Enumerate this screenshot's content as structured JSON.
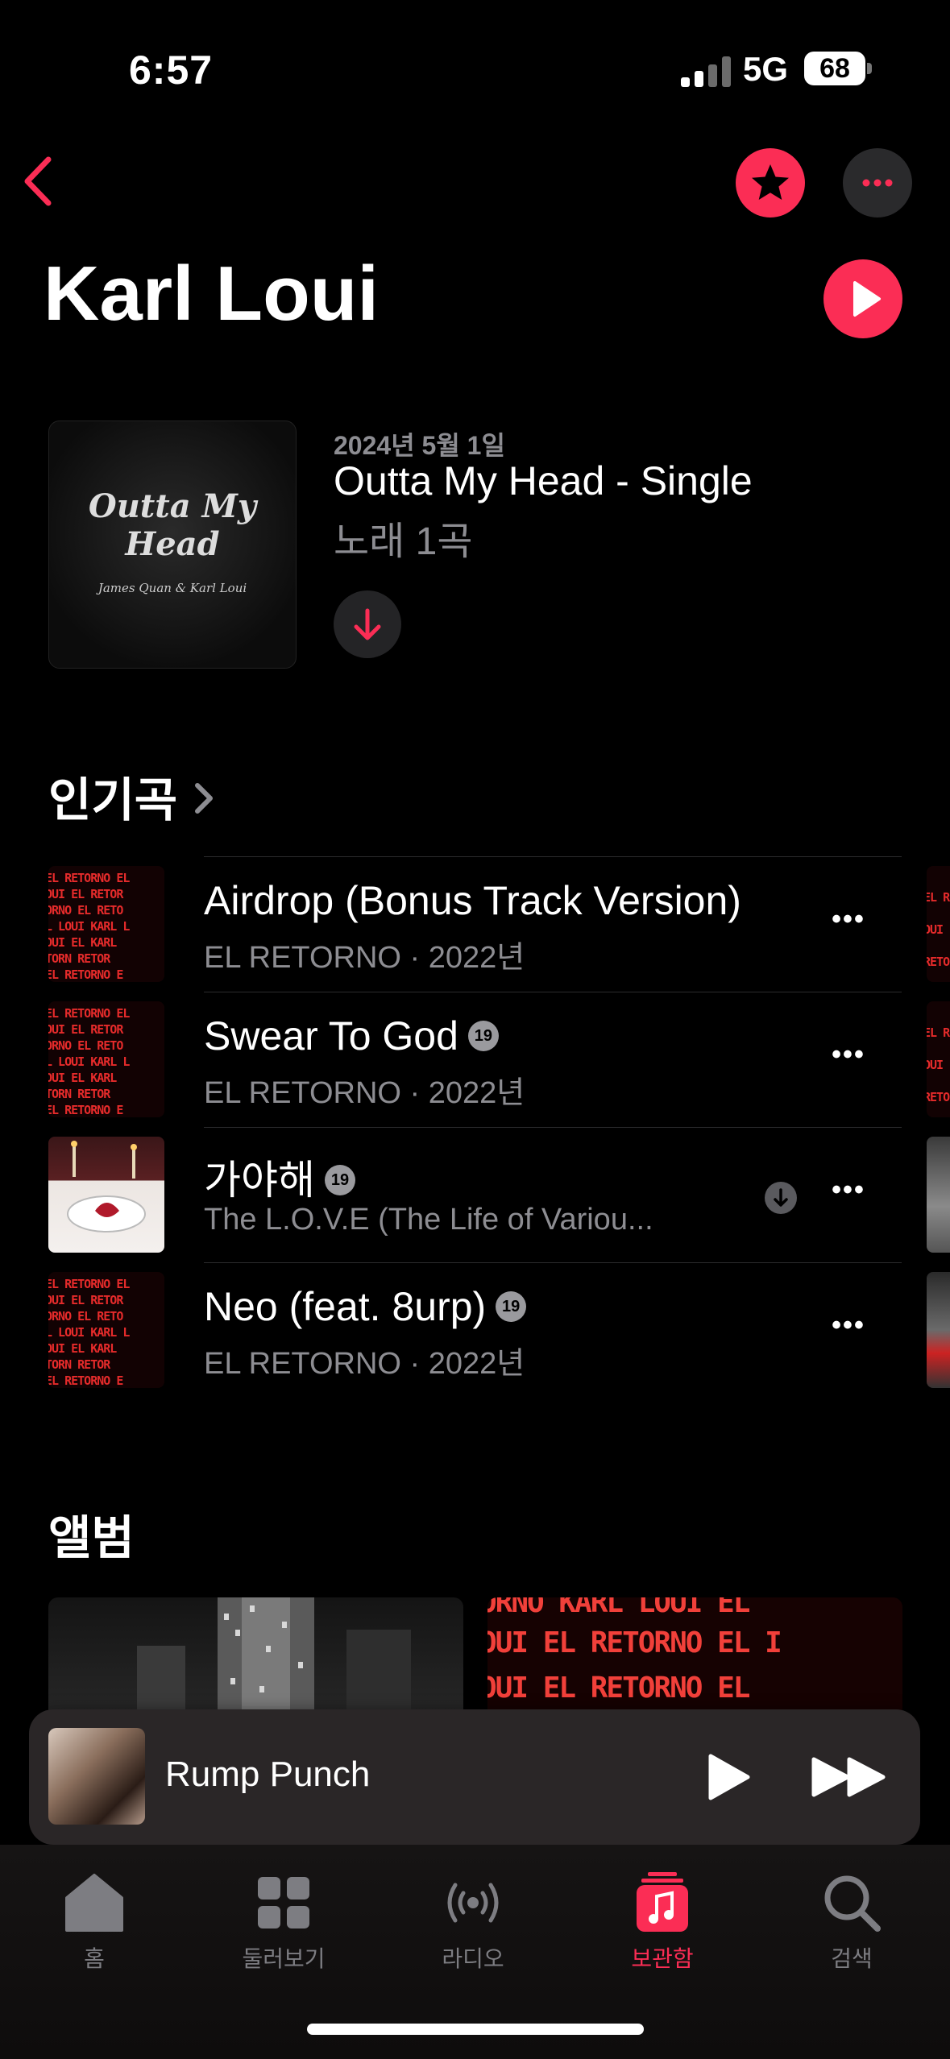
{
  "status_bar": {
    "time": "6:57",
    "network": "5G",
    "battery": "68"
  },
  "header": {
    "artist": "Karl Loui"
  },
  "latest_release": {
    "date": "2024년 5월 1일",
    "title": "Outta My Head - Single",
    "count": "노래 1곡",
    "art_title": "Outta My Head",
    "art_credit": "James Quan & Karl Loui"
  },
  "top_songs": {
    "heading": "인기곡",
    "items": [
      {
        "title": "Airdrop (Bonus Track Version)",
        "subtitle": "EL RETORNO · 2022년",
        "explicit": "",
        "art": "el-retorno"
      },
      {
        "title": "Swear To God",
        "subtitle": "EL RETORNO · 2022년",
        "explicit": "19",
        "art": "el-retorno"
      },
      {
        "title": "가야해",
        "subtitle": "The L.O.V.E (The Life of Variou...",
        "explicit": "19",
        "art": "love"
      },
      {
        "title": "Neo (feat. 8urp)",
        "subtitle": "EL RETORNO · 2022년",
        "explicit": "19",
        "art": "el-retorno"
      }
    ]
  },
  "albums": {
    "heading": "앨범",
    "art_text": "OUI EL RETORNO EL I"
  },
  "now_playing": {
    "title": "Rump Punch"
  },
  "tabs": [
    {
      "label": "홈",
      "icon": "home-icon"
    },
    {
      "label": "둘러보기",
      "icon": "browse-grid-icon"
    },
    {
      "label": "라디오",
      "icon": "radio-icon"
    },
    {
      "label": "보관함",
      "icon": "library-icon",
      "active": true
    },
    {
      "label": "검색",
      "icon": "search-icon"
    }
  ],
  "colors": {
    "accent": "#fb2d55",
    "background": "#000000",
    "secondary_text": "#8d8d92"
  }
}
